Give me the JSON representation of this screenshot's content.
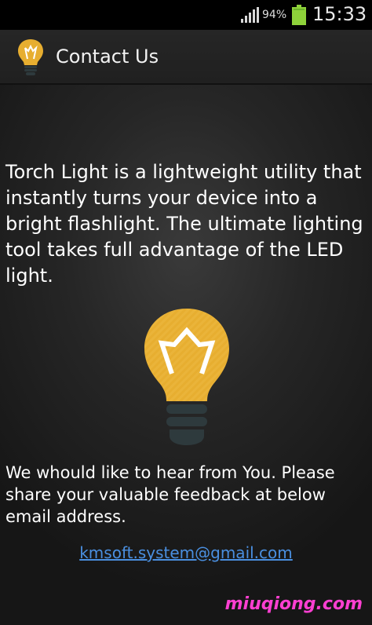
{
  "status_bar": {
    "battery_percent": "94%",
    "time": "15:33",
    "icons": [
      "signal-icon",
      "battery-icon"
    ]
  },
  "action_bar": {
    "icon": "lightbulb-icon",
    "title": "Contact Us"
  },
  "content": {
    "description": "Torch Light is a lightweight utility that instantly turns your device into a bright flashlight. The ultimate lighting tool takes full advantage of the LED light.",
    "illustration": "lightbulb-illustration",
    "feedback": "We whould like to hear from You. Please share your valuable feedback at below email address.",
    "email": "kmsoft.system@gmail.com"
  },
  "watermark": "miuqiong.com",
  "colors": {
    "bulb": "#e7ae30",
    "link": "#4a8fe0",
    "battery": "#8ed23a",
    "watermark": "#ff3fd2"
  }
}
